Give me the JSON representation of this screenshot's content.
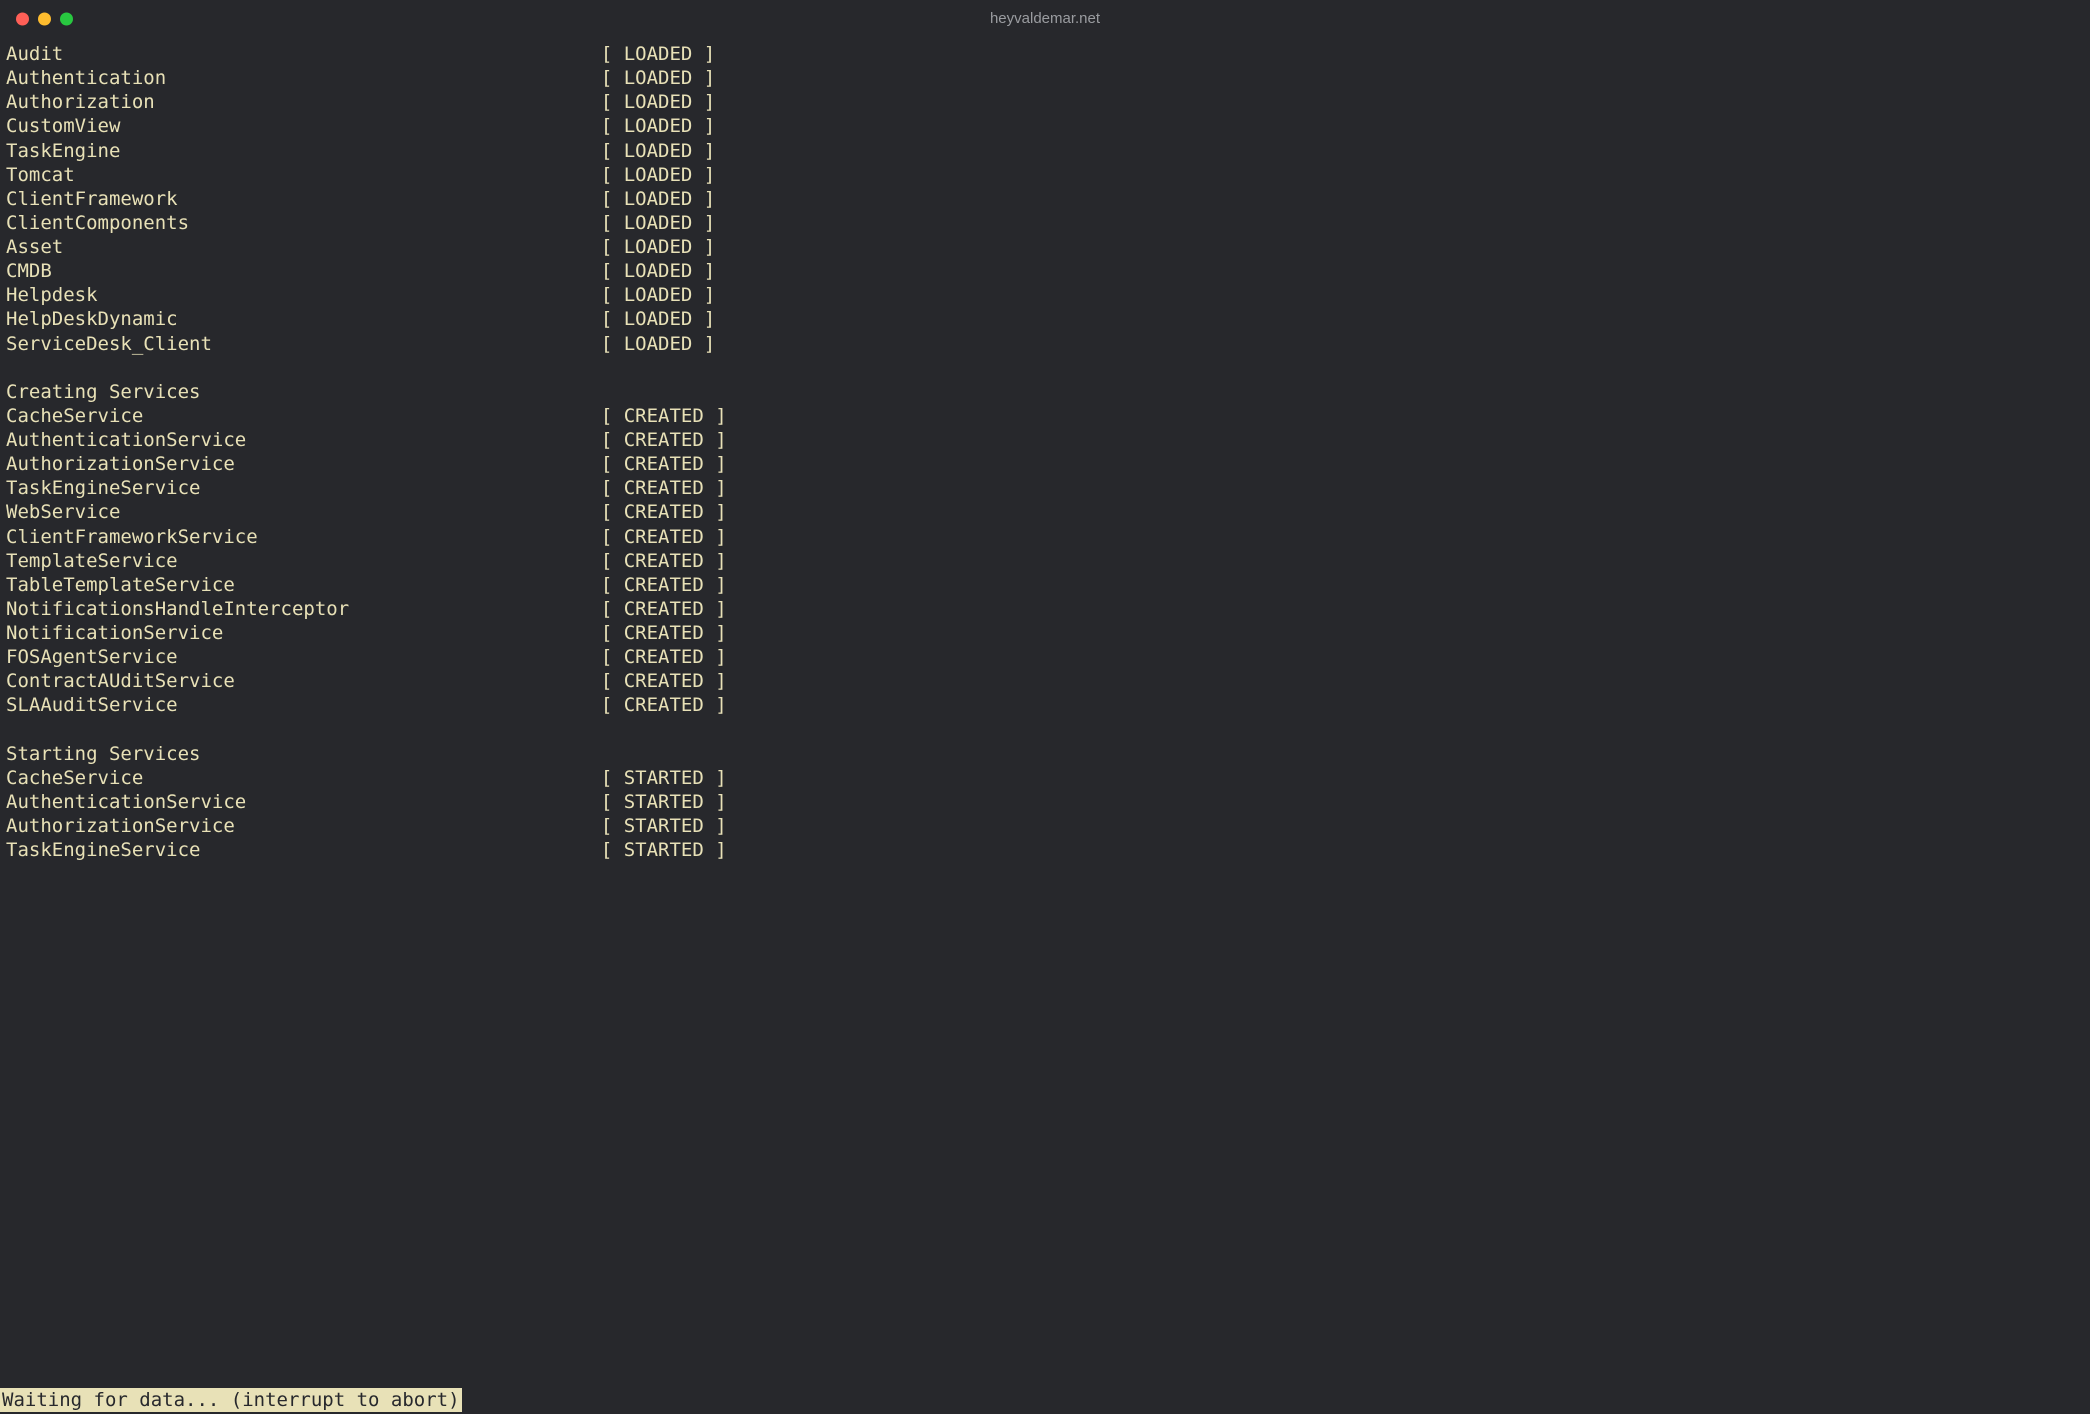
{
  "window": {
    "title": "heyvaldemar.net"
  },
  "name_col_width": 52,
  "sections": [
    {
      "header": null,
      "status": "LOADED",
      "items": [
        "Audit",
        "Authentication",
        "Authorization",
        "CustomView",
        "TaskEngine",
        "Tomcat",
        "ClientFramework",
        "ClientComponents",
        "Asset",
        "CMDB",
        "Helpdesk",
        "HelpDeskDynamic",
        "ServiceDesk_Client"
      ]
    },
    {
      "header": "Creating Services",
      "status": "CREATED",
      "items": [
        "CacheService",
        "AuthenticationService",
        "AuthorizationService",
        "TaskEngineService",
        "WebService",
        "ClientFrameworkService",
        "TemplateService",
        "TableTemplateService",
        "NotificationsHandleInterceptor",
        "NotificationService",
        "FOSAgentService",
        "ContractAUditService",
        "SLAAuditService"
      ]
    },
    {
      "header": "Starting Services",
      "status": "STARTED",
      "items": [
        "CacheService",
        "AuthenticationService",
        "AuthorizationService",
        "TaskEngineService"
      ]
    }
  ],
  "status_line": "Waiting for data... (interrupt to abort)"
}
